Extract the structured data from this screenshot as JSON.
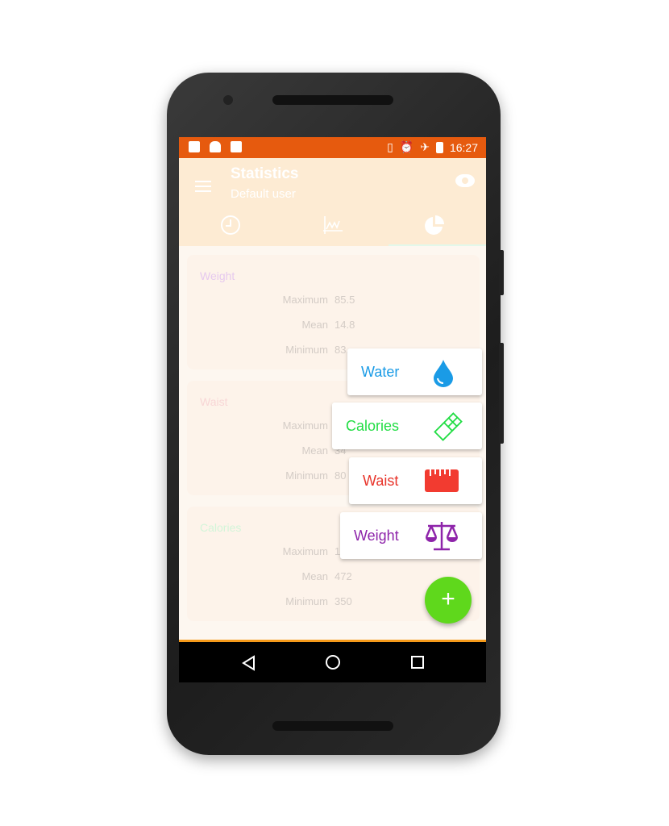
{
  "status_bar": {
    "time": "16:27",
    "icons": [
      "image-icon",
      "android-icon",
      "clipboard-check-icon",
      "vibrate-icon",
      "alarm-icon",
      "airplane-icon",
      "battery-charging-icon"
    ]
  },
  "app_bar": {
    "title": "Statistics",
    "subtitle": "Default user",
    "tabs": [
      "clock-icon",
      "line-chart-icon",
      "pie-chart-icon"
    ],
    "selected_tab": 2
  },
  "cards": [
    {
      "title": "Weight",
      "color": "#e6c9ee",
      "rows": [
        {
          "label": "Maximum",
          "value": "85.5"
        },
        {
          "label": "Mean",
          "value": "14.8"
        },
        {
          "label": "Minimum",
          "value": "83."
        }
      ]
    },
    {
      "title": "Waist",
      "color": "#f8d6d6",
      "rows": [
        {
          "label": "Maximum",
          "value": ""
        },
        {
          "label": "Mean",
          "value": "34"
        },
        {
          "label": "Minimum",
          "value": "80"
        }
      ]
    },
    {
      "title": "Calories",
      "color": "#d3f5d9",
      "rows": [
        {
          "label": "Maximum",
          "value": "1"
        },
        {
          "label": "Mean",
          "value": "472"
        },
        {
          "label": "Minimum",
          "value": "350"
        }
      ]
    }
  ],
  "fab_menu": [
    {
      "label": "Water",
      "color": "#1a9be6",
      "icon": "water-drop-icon"
    },
    {
      "label": "Calories",
      "color": "#22dd44",
      "icon": "chocolate-bar-icon"
    },
    {
      "label": "Waist",
      "color": "#e8342a",
      "icon": "ruler-icon"
    },
    {
      "label": "Weight",
      "color": "#8e24aa",
      "icon": "scale-icon"
    }
  ],
  "fab": {
    "label": "+",
    "color": "#5fd81c"
  }
}
